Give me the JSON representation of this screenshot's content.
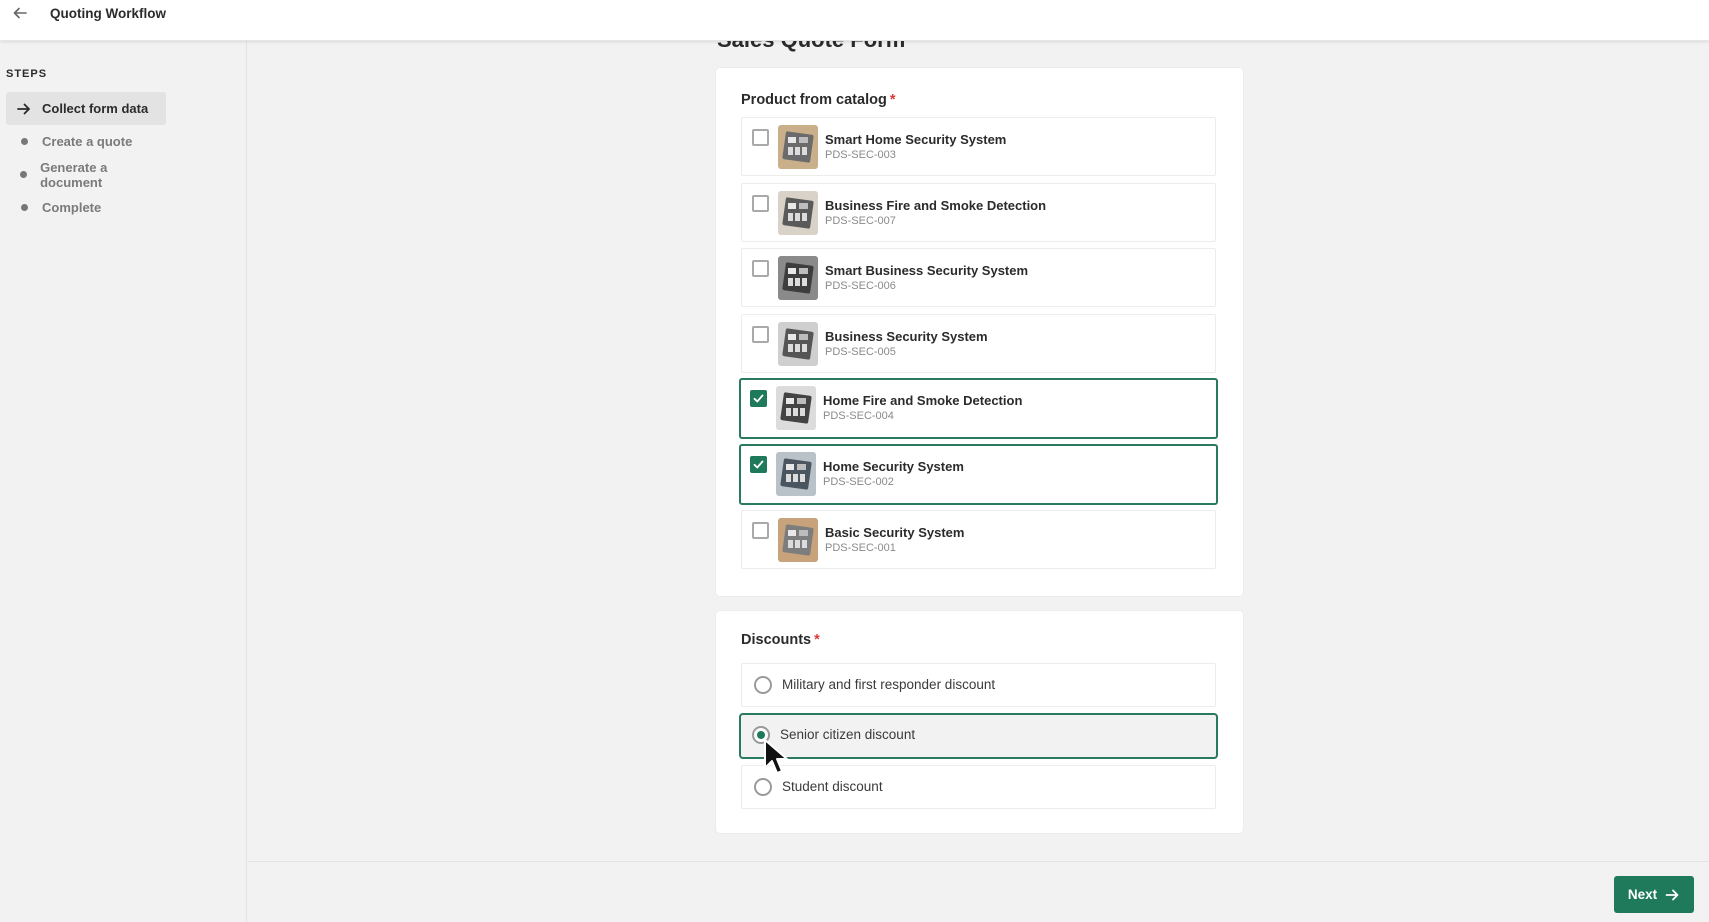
{
  "header": {
    "back_icon": "arrow-left-icon",
    "title": "Quoting Workflow"
  },
  "sidebar": {
    "section_label": "STEPS",
    "steps": [
      {
        "label": "Collect form data",
        "icon": "arrow-right-icon",
        "active": true
      },
      {
        "label": "Create a quote",
        "icon": "bullet-dot-icon",
        "active": false
      },
      {
        "label": "Generate a document",
        "icon": "bullet-dot-icon",
        "active": false
      },
      {
        "label": "Complete",
        "icon": "bullet-dot-icon",
        "active": false
      }
    ]
  },
  "form": {
    "title": "Sales Quote Form",
    "products": {
      "label": "Product from catalog",
      "required_mark": "*",
      "items": [
        {
          "name": "Smart Home Security System",
          "code": "PDS-SEC-003",
          "checked": false
        },
        {
          "name": "Business Fire and Smoke Detection",
          "code": "PDS-SEC-007",
          "checked": false
        },
        {
          "name": "Smart Business Security System",
          "code": "PDS-SEC-006",
          "checked": false
        },
        {
          "name": "Business Security System",
          "code": "PDS-SEC-005",
          "checked": false
        },
        {
          "name": "Home Fire and Smoke Detection",
          "code": "PDS-SEC-004",
          "checked": true
        },
        {
          "name": "Home Security System",
          "code": "PDS-SEC-002",
          "checked": true
        },
        {
          "name": "Basic Security System",
          "code": "PDS-SEC-001",
          "checked": false
        }
      ]
    },
    "discounts": {
      "label": "Discounts",
      "required_mark": "*",
      "options": [
        {
          "label": "Military and first responder discount",
          "selected": false
        },
        {
          "label": "Senior citizen discount",
          "selected": true
        },
        {
          "label": "Student discount",
          "selected": false
        }
      ]
    }
  },
  "footer": {
    "next_label": "Next",
    "next_icon": "arrow-right-icon"
  },
  "colors": {
    "accent": "#1f7a5c",
    "selected_border": "#2a7a5e",
    "required": "#d93a3a",
    "background": "#f2f2f2"
  }
}
